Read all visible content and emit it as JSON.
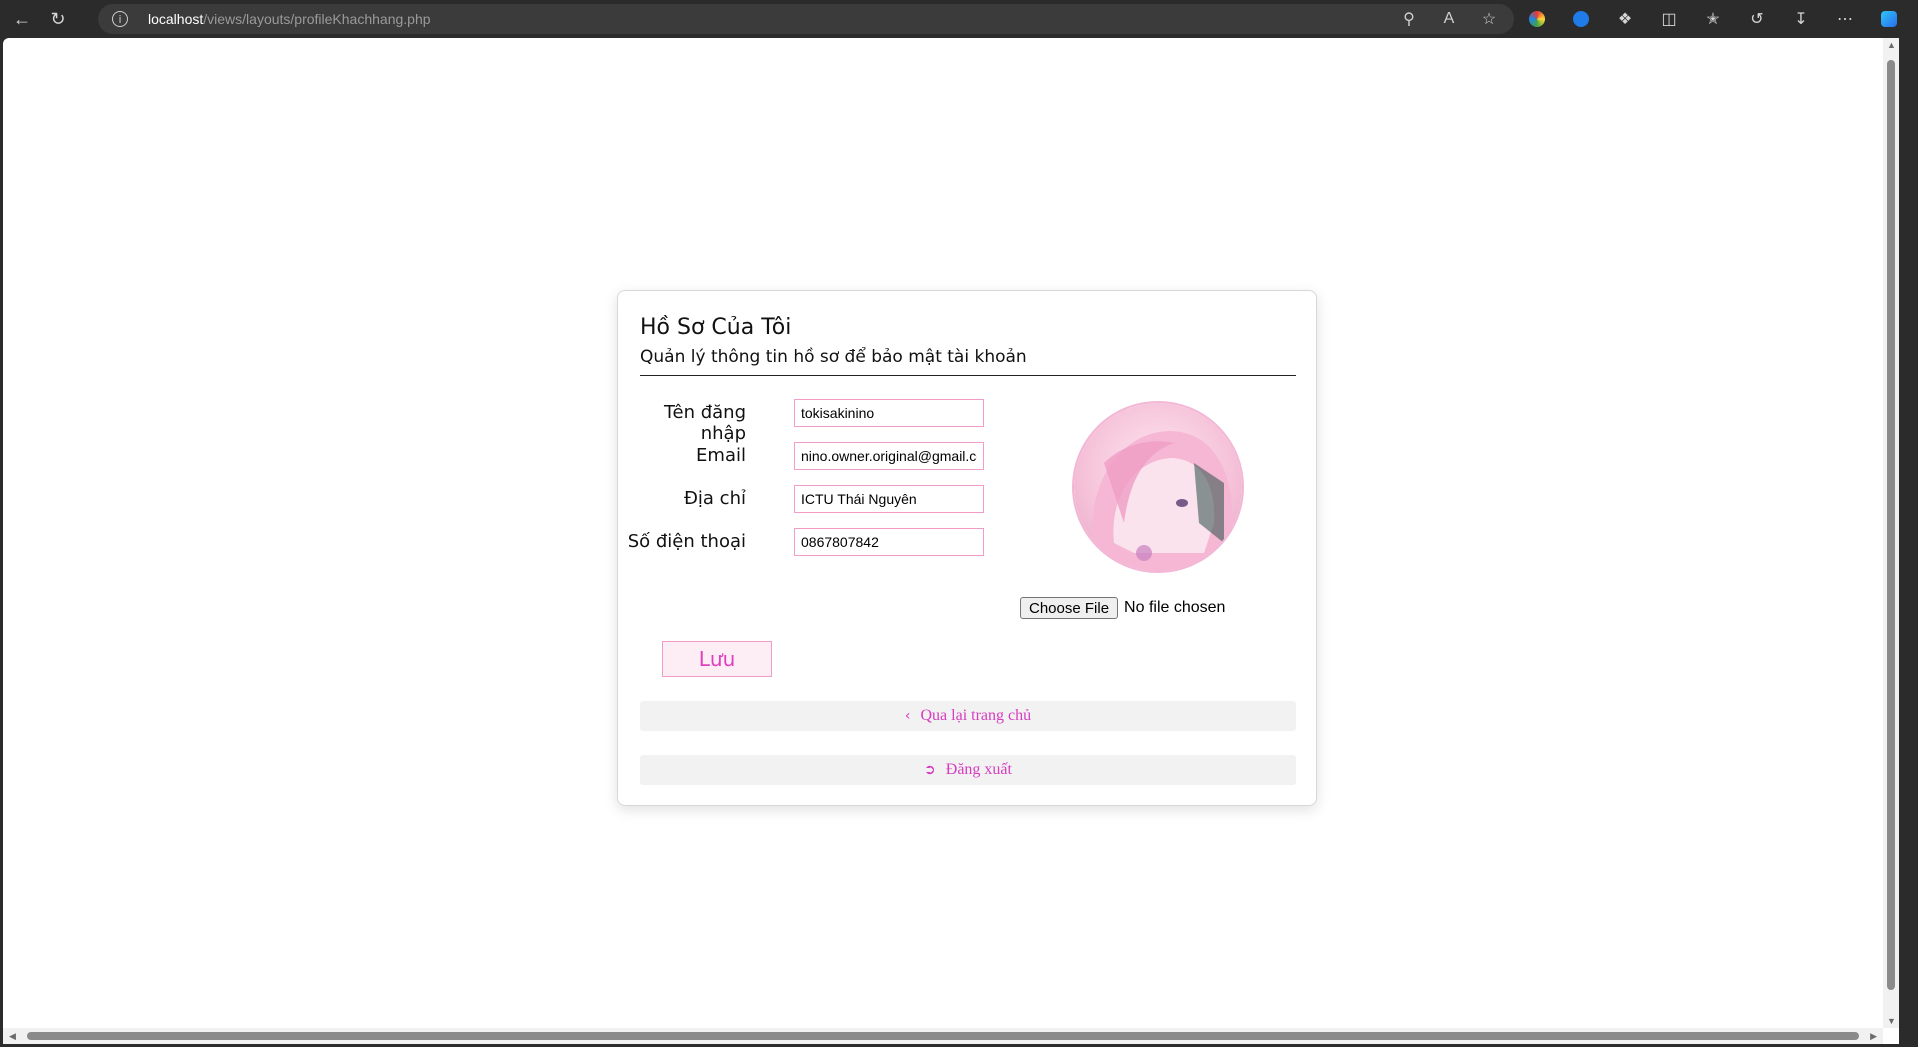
{
  "browser": {
    "url_host": "localhost",
    "url_path": "/views/layouts/profileKhachhang.php"
  },
  "profile": {
    "title": "Hồ Sơ Của Tôi",
    "subtitle": "Quản lý thông tin hồ sơ để bảo mật tài khoản",
    "fields": [
      {
        "label": "Tên đăng nhập",
        "value": "tokisakinino"
      },
      {
        "label": "Email",
        "value": "nino.owner.original@gmail.com"
      },
      {
        "label": "Địa chỉ",
        "value": "ICTU Thái Nguyên"
      },
      {
        "label": "Số điện thoại",
        "value": "0867807842"
      }
    ],
    "save_label": "Lưu",
    "file_button_label": "Choose File",
    "file_status": "No file chosen",
    "back_link": "Qua lại trang chủ",
    "logout_link": "Đăng xuất"
  },
  "colors": {
    "accent": "#d63cc0",
    "input_border": "#f29cc8"
  }
}
